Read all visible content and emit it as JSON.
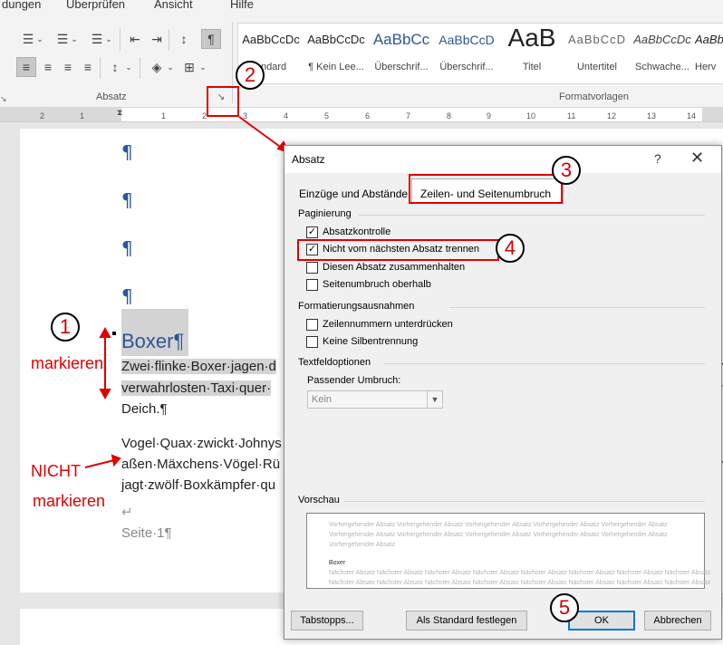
{
  "ribbon": {
    "tabs": [
      "dungen",
      "Überprüfen",
      "Ansicht",
      "Hilfe"
    ],
    "group_absatz": "Absatz",
    "group_formatvorlagen": "Formatvorlagen",
    "styles": [
      {
        "sample": "AaBbCcDc",
        "name": "Standard",
        "display_name": "andard"
      },
      {
        "sample": "AaBbCcDc",
        "name": "¶ Kein Lee..."
      },
      {
        "sample": "AaBbCc",
        "name": "Überschrif..."
      },
      {
        "sample": "AaBbCcD",
        "name": "Überschrif..."
      },
      {
        "sample": "AaB",
        "name": "Titel"
      },
      {
        "sample": "AaBbCcD",
        "name": "Untertitel"
      },
      {
        "sample": "AaBbCcDc",
        "name": "Schwache..."
      },
      {
        "sample": "AaBbCcDc",
        "name": "Herv"
      }
    ]
  },
  "ruler": {
    "numbers": [
      "2",
      "1",
      "1",
      "2",
      "3",
      "4",
      "5",
      "6",
      "7",
      "8",
      "9",
      "10",
      "11",
      "12",
      "13",
      "14",
      "15"
    ]
  },
  "document": {
    "pilcrow": "¶",
    "heading": "Boxer¶",
    "para1": [
      "Zwei·flinke·Boxer·jagen·d",
      "verwahrlosten·Taxi·quer·",
      "Deich.¶"
    ],
    "para2": [
      "Vogel·Quax·zwickt·Johnys",
      "aßen·Mäxchens·Vögel·Rü",
      "jagt·zwölf·Boxkämpfer·qu"
    ],
    "break_mark": "↵",
    "page_label": "Seite·1¶",
    "right_frags": [
      "n·",
      "h",
      "n·"
    ]
  },
  "annotations": {
    "circle1": "1",
    "circle2": "2",
    "circle3": "3",
    "circle4": "4",
    "circle5": "5",
    "markieren": "markieren",
    "nicht": "NICHT",
    "markieren2": "markieren"
  },
  "dialog": {
    "title": "Absatz",
    "help": "?",
    "close": "✕",
    "tab1": "Einzüge und Abstände",
    "tab2": "Zeilen- und Seitenumbruch",
    "sect_paginierung": "Paginierung",
    "cb_absatzkontrolle": {
      "label": "Absatzkontrolle",
      "checked": true
    },
    "cb_nicht_trennen": {
      "label": "Nicht vom nächsten Absatz trennen",
      "checked": true
    },
    "cb_zusammenhalten": {
      "label": "Diesen Absatz zusammenhalten",
      "checked": false
    },
    "cb_seitenumbruch": {
      "label": "Seitenumbruch oberhalb",
      "checked": false
    },
    "sect_ausnahmen": "Formatierungsausnahmen",
    "cb_zeilennummern": {
      "label": "Zeilennummern unterdrücken",
      "checked": false
    },
    "cb_silbentrennung": {
      "label": "Keine Silbentrennung",
      "checked": false
    },
    "sect_textfeld": "Textfeldoptionen",
    "umbruch_label": "Passender Umbruch:",
    "umbruch_value": "Kein",
    "sect_vorschau": "Vorschau",
    "preview_prev": [
      "Vorhergehender Absatz Vorhergehender Absatz Vorhergehender Absatz Vorhergehender Absatz Vorhergehender Absatz",
      "Vorhergehender Absatz Vorhergehender Absatz Vorhergehender Absatz Vorhergehender Absatz Vorhergehender Absatz",
      "Vorhergehender Absatz"
    ],
    "preview_current": "Boxer",
    "preview_next": [
      "Nächster Absatz Nächster Absatz Nächster Absatz Nächster Absatz Nächster Absatz Nächster Absatz Nächster Absatz Nächster Absatz",
      "Nächster Absatz Nächster Absatz Nächster Absatz Nächster Absatz Nächster Absatz Nächster Absatz Nächster Absatz Nächster Absatz"
    ],
    "btn_tabstopps": "Tabstopps...",
    "btn_standard": "Als Standard festlegen",
    "btn_ok": "OK",
    "btn_abbrechen": "Abbrechen"
  },
  "colors": {
    "accent": "#2f5597",
    "annotation_red": "#e00000",
    "focus": "#0078d7"
  }
}
